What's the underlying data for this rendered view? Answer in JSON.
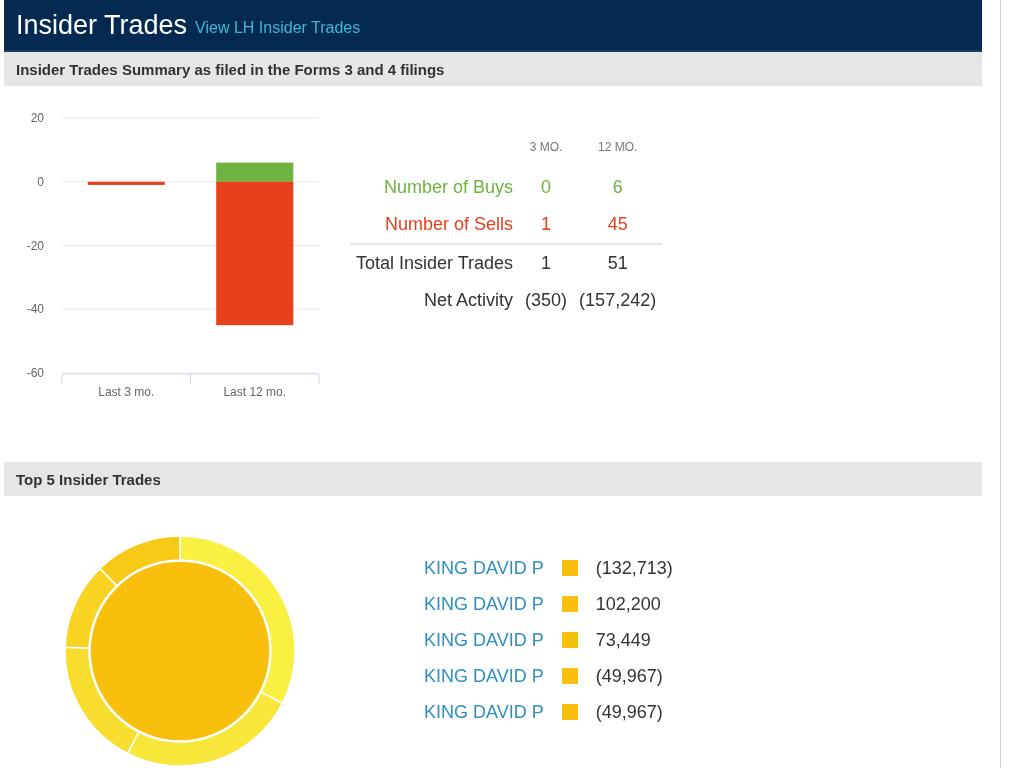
{
  "header": {
    "title": "Insider Trades",
    "link": "View LH Insider Trades"
  },
  "summary": {
    "heading": "Insider Trades Summary as filed in the Forms 3 and 4 filings",
    "chart_data": {
      "type": "bar",
      "stacked": true,
      "grid": true,
      "categories": [
        "Last 3 mo.",
        "Last 12 mo."
      ],
      "ylim": [
        -60,
        20
      ],
      "yticks": [
        20,
        0,
        -20,
        -40,
        -60
      ],
      "series": [
        {
          "color": "#6db33f",
          "values": [
            0,
            6
          ]
        },
        {
          "color": "#e8401c",
          "values": [
            -1,
            -45
          ]
        }
      ]
    },
    "columns": [
      "3 MO.",
      "12 MO."
    ],
    "rows": [
      {
        "kind": "buys",
        "label": "Number of Buys",
        "values": [
          "0",
          "6"
        ]
      },
      {
        "kind": "sells",
        "label": "Number of Sells",
        "values": [
          "1",
          "45"
        ]
      },
      {
        "kind": "total",
        "label": "Total Insider Trades",
        "values": [
          "1",
          "51"
        ]
      },
      {
        "kind": "plain",
        "label": "Net Activity",
        "values": [
          "(350)",
          "(157,242)"
        ]
      }
    ]
  },
  "top": {
    "heading": "Top 5 Insider Trades",
    "chart_data": {
      "type": "donut",
      "categories": [
        "KING DAVID P",
        "KING DAVID P",
        "KING DAVID P",
        "KING DAVID P",
        "KING DAVID P"
      ],
      "values": [
        32.5,
        25.03,
        17.99,
        12.24,
        12.24
      ]
    },
    "legend": [
      {
        "amount": "(132,713)",
        "color": "#f8bf0d"
      },
      {
        "amount": "102,200",
        "color": "#f8bf0d"
      },
      {
        "amount": "73,449",
        "color": "#f8bf0d"
      },
      {
        "amount": "(49,967)",
        "color": "#f8bf0d"
      },
      {
        "amount": "(49,967)",
        "color": "#f8bf0d"
      }
    ]
  }
}
